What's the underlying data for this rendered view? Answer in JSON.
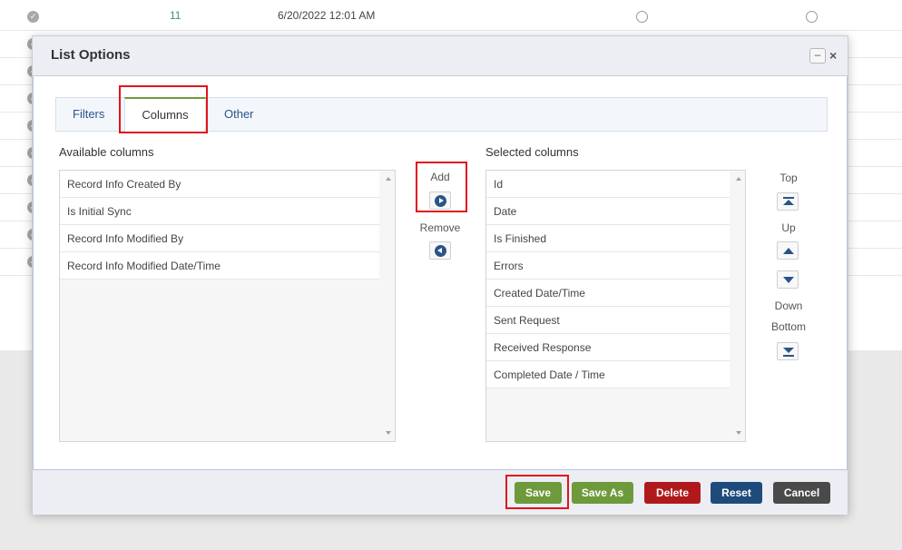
{
  "background_grid": {
    "first_row": {
      "id": "11",
      "date": "6/20/2022 12:01 AM"
    }
  },
  "modal": {
    "title": "List Options",
    "minimize_symbol": "–",
    "close_symbol": "×"
  },
  "tabs": [
    {
      "label": "Filters",
      "active": false
    },
    {
      "label": "Columns",
      "active": true
    },
    {
      "label": "Other",
      "active": false
    }
  ],
  "available": {
    "heading": "Available columns",
    "items": [
      "Record Info Created By",
      "Is Initial Sync",
      "Record Info Modified By",
      "Record Info Modified Date/Time"
    ]
  },
  "selected": {
    "heading": "Selected columns",
    "items": [
      "Id",
      "Date",
      "Is Finished",
      "Errors",
      "Created Date/Time",
      "Sent Request",
      "Received Response",
      "Completed Date / Time"
    ]
  },
  "transfer": {
    "add_label": "Add",
    "remove_label": "Remove"
  },
  "order": {
    "top_label": "Top",
    "up_label": "Up",
    "down_label": "Down",
    "bottom_label": "Bottom"
  },
  "footer": {
    "save_label": "Save",
    "save_as_label": "Save As",
    "delete_label": "Delete",
    "reset_label": "Reset",
    "cancel_label": "Cancel"
  },
  "colors": {
    "accent_blue": "#2a5488",
    "highlight_red": "#e0141b",
    "save_green": "#6e9a3c",
    "delete_red": "#b0191b",
    "reset_navy": "#1e4b7c",
    "cancel_gray": "#4a4a4a"
  }
}
